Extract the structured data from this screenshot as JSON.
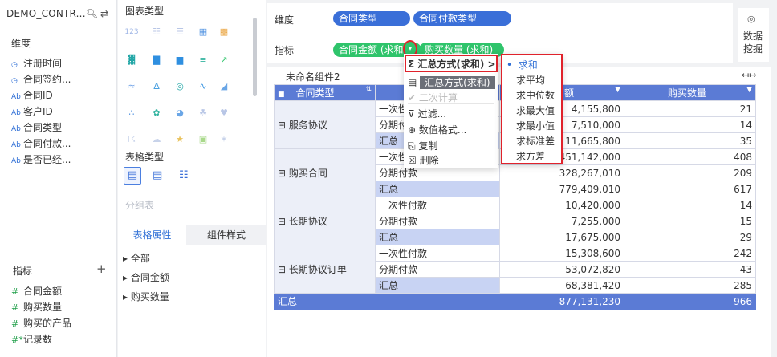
{
  "left_panel": {
    "title": "DEMO_CONTR...",
    "dimension_section": "维度",
    "dimensions": [
      {
        "type": "clock",
        "label": "注册时间"
      },
      {
        "type": "clock",
        "label": "合同签约..."
      },
      {
        "type": "Ab",
        "label": "合同ID"
      },
      {
        "type": "Ab",
        "label": "客户ID"
      },
      {
        "type": "Ab",
        "label": "合同类型"
      },
      {
        "type": "Ab",
        "label": "合同付款..."
      },
      {
        "type": "Ab",
        "label": "是否已经..."
      }
    ],
    "metric_section": "指标",
    "add_symbol": "+",
    "metrics": [
      {
        "type": "#",
        "label": "合同金额"
      },
      {
        "type": "#",
        "label": "购买数量"
      },
      {
        "type": "#",
        "label": "购买的产品"
      },
      {
        "type": "#*",
        "label": "记录数"
      }
    ]
  },
  "chart_panel": {
    "chart_type_label": "图表类型",
    "table_type_label": "表格类型",
    "group_table_label": "分组表",
    "tabs": [
      "表格属性",
      "组件样式"
    ],
    "tree_items": [
      "全部",
      "合同金额",
      "购买数量"
    ],
    "number_icon_text": "123"
  },
  "config": {
    "dimension_label": "维度",
    "dimension_pills": [
      "合同类型",
      "合同付款类型"
    ],
    "metric_label": "指标",
    "metric_pills": [
      "合同金额 (求和)",
      "购买数量 (求和)"
    ],
    "data_mining": [
      "数据",
      "挖掘"
    ]
  },
  "component": {
    "title": "未命名组件2",
    "headers": [
      "合同类型",
      "合",
      "额",
      "购买数量"
    ],
    "rows": [
      {
        "group": "服务协议",
        "sub": [
          {
            "pay": "一次性付",
            "amount": "4,155,800",
            "qty": "21"
          },
          {
            "pay": "分期付",
            "amount": "7,510,000",
            "qty": "14"
          },
          {
            "pay": "汇总",
            "amount": "11,665,800",
            "qty": "35"
          }
        ]
      },
      {
        "group": "购买合同",
        "sub": [
          {
            "pay": "一次性",
            "amount": "451,142,000",
            "qty": "408"
          },
          {
            "pay": "分期付款",
            "amount": "328,267,010",
            "qty": "209"
          },
          {
            "pay": "汇总",
            "amount": "779,409,010",
            "qty": "617"
          }
        ]
      },
      {
        "group": "长期协议",
        "sub": [
          {
            "pay": "一次性付款",
            "amount": "10,420,000",
            "qty": "14"
          },
          {
            "pay": "分期付款",
            "amount": "7,255,000",
            "qty": "15"
          },
          {
            "pay": "汇总",
            "amount": "17,675,000",
            "qty": "29"
          }
        ]
      },
      {
        "group": "长期协议订单",
        "sub": [
          {
            "pay": "一次性付款",
            "amount": "15,308,600",
            "qty": "242"
          },
          {
            "pay": "分期付款",
            "amount": "53,072,820",
            "qty": "43"
          },
          {
            "pay": "汇总",
            "amount": "68,381,420",
            "qty": "285"
          }
        ]
      }
    ],
    "grand_total": {
      "label": "汇总",
      "amount": "877,131,230",
      "qty": "966"
    }
  },
  "context_menu": {
    "items": [
      "汇总方式(求和)",
      "汇总方式(求和)",
      "二次计算",
      "过滤...",
      "数值格式...",
      "复制",
      "删除"
    ],
    "arrow": ">"
  },
  "submenu": {
    "items": [
      "求和",
      "求平均",
      "求中位数",
      "求最大值",
      "求最小值",
      "求标准差",
      "求方差"
    ],
    "selected_index": 0
  },
  "colors": {
    "accent": "#3a6fd8",
    "green": "#2fc46b",
    "header": "#5b7bd5",
    "highlight": "#e0222b"
  }
}
